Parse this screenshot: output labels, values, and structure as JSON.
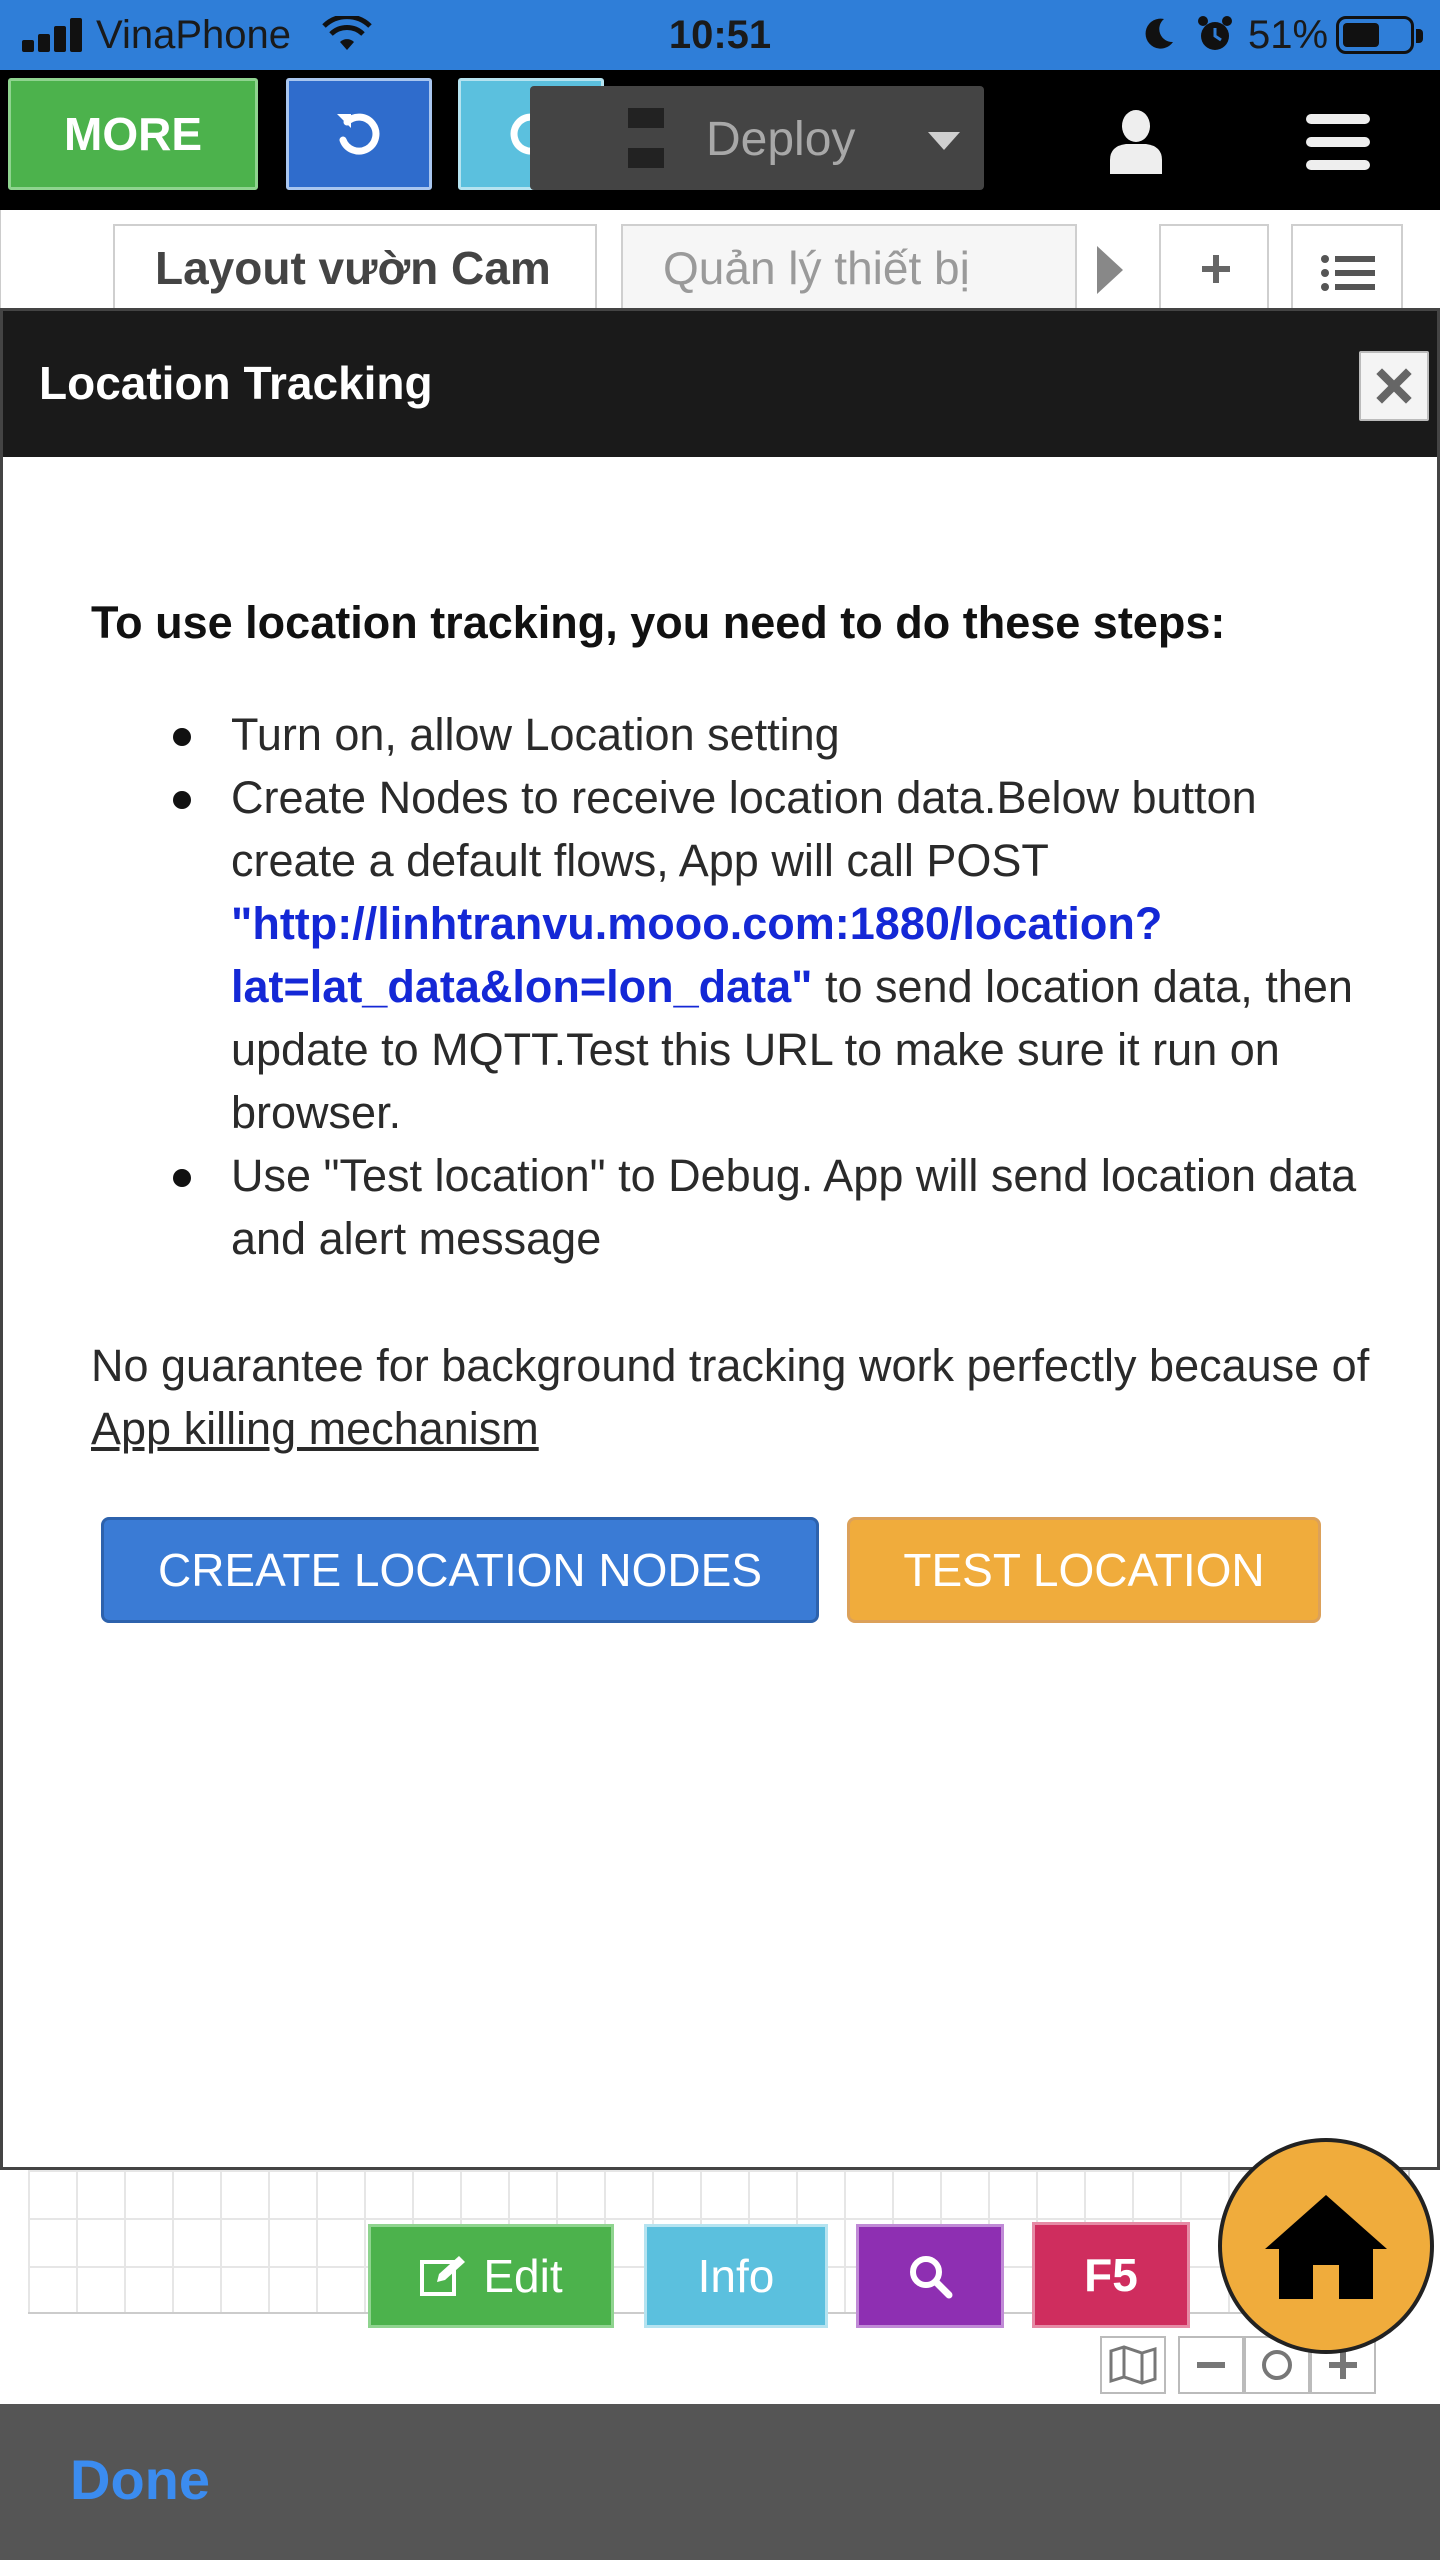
{
  "status_bar": {
    "carrier": "VinaPhone",
    "time": "10:51",
    "battery_percent": "51%"
  },
  "toolbar": {
    "more_label": "MORE",
    "deploy_label": "Deploy"
  },
  "tabs": [
    {
      "label": "Layout vườn Cam",
      "active": true
    },
    {
      "label": "Quản lý thiết bị",
      "active": false
    }
  ],
  "modal": {
    "title": "Location Tracking",
    "intro": "To use location tracking, you need to do these steps:",
    "steps": {
      "step1": "Turn on, allow Location setting",
      "step2_before": "Create Nodes to receive location data.Below button create a default flows, App will call POST ",
      "step2_url": "\"http://linhtranvu.mooo.com:1880/location?lat=lat_data&lon=lon_data\"",
      "step2_after": " to send location data, then update to MQTT.Test this URL to make sure it run on browser.",
      "step3": "Use \"Test location\" to Debug. App will send location data and alert message"
    },
    "note_before": "No guarantee for background tracking work perfectly because of ",
    "note_link": "App killing mechanism",
    "create_button": "CREATE LOCATION NODES",
    "test_button": "TEST LOCATION"
  },
  "bottom_toolbar": {
    "edit_label": "Edit",
    "info_label": "Info",
    "f5_label": "F5"
  },
  "done_label": "Done",
  "colors": {
    "status_bar_bg": "#2f7ed8",
    "more_green": "#4cb24c",
    "undo_blue": "#2f6ccc",
    "redo_cyan": "#5bc0de",
    "create_blue": "#3a7bd5",
    "test_orange": "#f0ac3c",
    "search_purple": "#8e2fb2",
    "f5_red": "#cf2d5e",
    "url_blue": "#1428d6",
    "done_blue": "#3b8cf0"
  },
  "icons": [
    "signal-icon",
    "wifi-icon",
    "moon-icon",
    "alarm-icon",
    "battery-icon",
    "undo-icon",
    "redo-icon",
    "deploy-icon",
    "caret-down-icon",
    "user-icon",
    "hamburger-menu-icon",
    "chevron-right-icon",
    "plus-icon",
    "list-icon",
    "close-icon",
    "edit-icon",
    "search-icon",
    "home-icon",
    "map-icon",
    "zoom-out-icon",
    "zoom-reset-icon",
    "zoom-in-icon"
  ]
}
